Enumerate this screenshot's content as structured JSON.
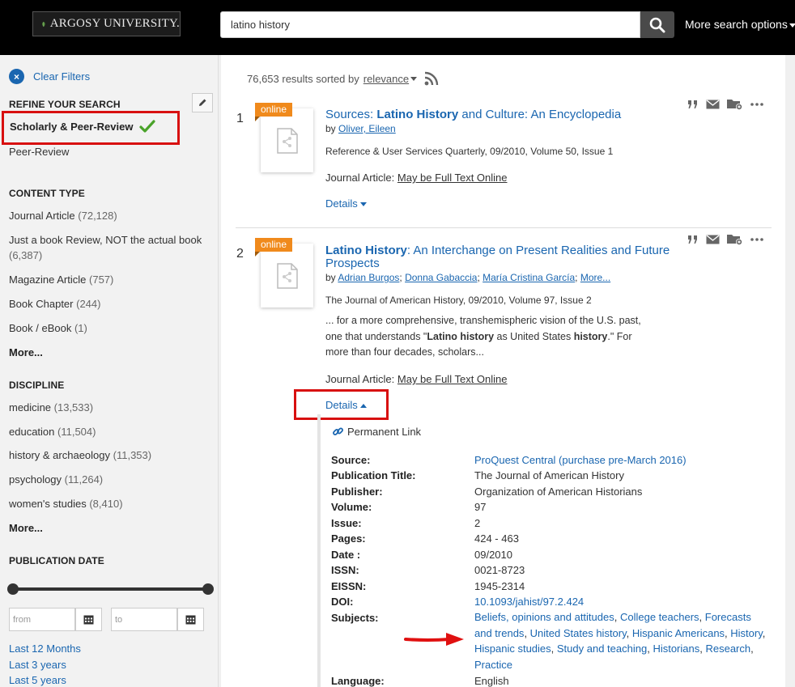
{
  "header": {
    "logo_text": "ARGOSY UNIVERSITY.",
    "search_value": "latino history",
    "more_options_label": "More search options"
  },
  "sidebar": {
    "clear_filters": "Clear Filters",
    "refine_heading": "REFINE YOUR SEARCH",
    "scholarly_label": "Scholarly & Peer-Review",
    "peer_review_label": "Peer-Review",
    "content_type_heading": "CONTENT TYPE",
    "content_types": [
      {
        "label": "Journal Article",
        "count": "(72,128)"
      },
      {
        "label": "Just a book Review, NOT the actual book",
        "count": "(6,387)"
      },
      {
        "label": "Magazine Article",
        "count": "(757)"
      },
      {
        "label": "Book Chapter",
        "count": "(244)"
      },
      {
        "label": "Book / eBook",
        "count": "(1)"
      }
    ],
    "content_more": "More...",
    "discipline_heading": "DISCIPLINE",
    "disciplines": [
      {
        "label": "medicine",
        "count": "(13,533)"
      },
      {
        "label": "education",
        "count": "(11,504)"
      },
      {
        "label": "history & archaeology",
        "count": "(11,353)"
      },
      {
        "label": "psychology",
        "count": "(11,264)"
      },
      {
        "label": "women's studies",
        "count": "(8,410)"
      }
    ],
    "discipline_more": "More...",
    "pub_date_heading": "PUBLICATION DATE",
    "from_placeholder": "from",
    "to_placeholder": "to",
    "date_links": [
      "Last 12 Months",
      "Last 3 years",
      "Last 5 years"
    ]
  },
  "results": {
    "summary": "76,653 results sorted by",
    "sort_value": "relevance",
    "items": [
      {
        "num": "1",
        "badge": "online",
        "title_pre": "Sources: ",
        "title_bold": "Latino History",
        "title_post": " and Culture: An Encyclopedia",
        "by_label": "by",
        "authors": [
          "Oliver, Eileen"
        ],
        "source": "Reference & User Services Quarterly, 09/2010, Volume 50, Issue 1",
        "type_label": "Journal Article:",
        "fulltext": "May be Full Text Online",
        "details": "Details"
      },
      {
        "num": "2",
        "badge": "online",
        "title_bold": "Latino History",
        "title_post": ": An Interchange on Present Realities and Future",
        "title_line2": "Prospects",
        "by_label": "by",
        "authors": [
          "Adrian Burgos",
          "Donna Gabaccia",
          "María Cristina García",
          "More..."
        ],
        "source": "The Journal of American History, 09/2010, Volume 97, Issue 2",
        "snippet_1": "... for a more comprehensive, transhemispheric vision of the U.S. past,",
        "snippet_2a": "one that understands \"",
        "snippet_2b": "Latino history",
        "snippet_2c": " as United States ",
        "snippet_2d": "history",
        "snippet_2e": ".\" For",
        "snippet_3": "more than four decades, scholars...",
        "type_label": "Journal Article:",
        "fulltext": "May be Full Text Online",
        "details": "Details",
        "permanent_link": "Permanent Link",
        "fields": [
          {
            "label": "Source:",
            "value": "ProQuest Central (purchase pre-March 2016)",
            "link": true
          },
          {
            "label": "Publication Title:",
            "value": "The Journal of American History",
            "link": false
          },
          {
            "label": "Publisher:",
            "value": "Organization of American Historians",
            "link": false
          },
          {
            "label": "Volume:",
            "value": "97",
            "link": false
          },
          {
            "label": "Issue:",
            "value": "2",
            "link": false
          },
          {
            "label": "Pages:",
            "value": "424 - 463",
            "link": false
          },
          {
            "label": "Date :",
            "value": "09/2010",
            "link": false
          },
          {
            "label": "ISSN:",
            "value": "0021-8723",
            "link": false
          },
          {
            "label": "EISSN:",
            "value": "1945-2314",
            "link": false
          },
          {
            "label": "DOI:",
            "value": "10.1093/jahist/97.2.424",
            "link": true
          }
        ],
        "subjects_label": "Subjects:",
        "subjects": [
          "Beliefs, opinions and attitudes",
          "College teachers",
          "Forecasts and trends",
          "United States history",
          "Hispanic Americans",
          "History",
          "Hispanic studies",
          "Study and teaching",
          "Historians",
          "Research",
          "Practice"
        ],
        "language_label": "Language:",
        "language": "English"
      }
    ]
  },
  "colors": {
    "accent": "#1a66b0",
    "badge": "#f08a1c",
    "highlight": "#d81010",
    "check": "#4aa32a"
  }
}
